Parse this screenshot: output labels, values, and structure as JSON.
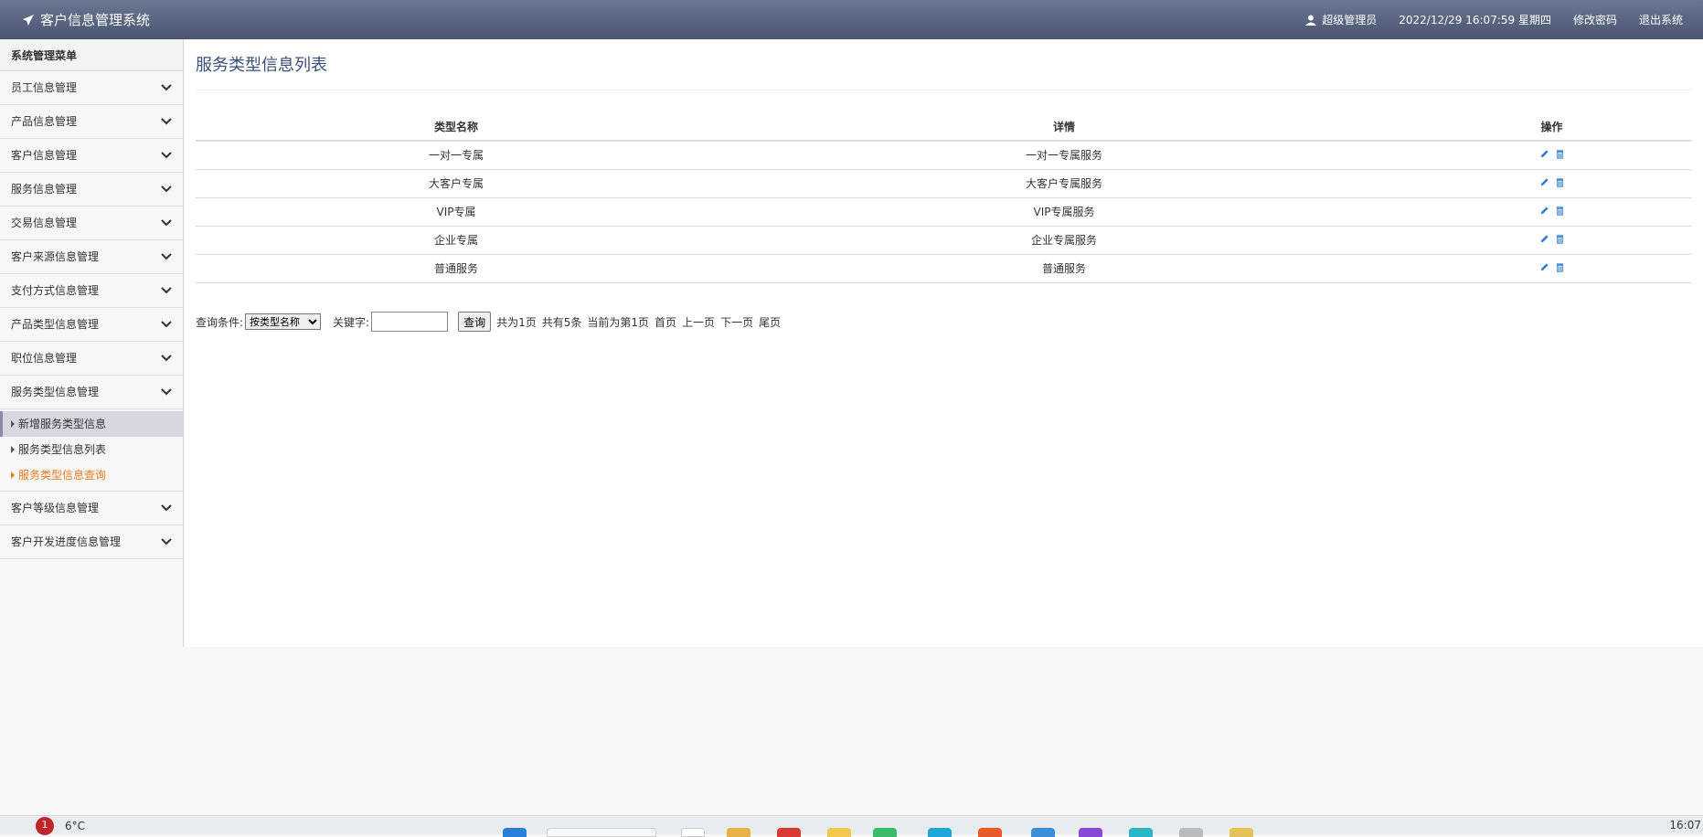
{
  "app": {
    "title": "客户信息管理系统",
    "user": "超级管理员",
    "datetime": "2022/12/29 16:07:59 星期四",
    "change_password": "修改密码",
    "logout": "退出系统"
  },
  "sidebar": {
    "header": "系统管理菜单",
    "items_top": [
      {
        "label": "员工信息管理"
      },
      {
        "label": "产品信息管理"
      },
      {
        "label": "客户信息管理"
      },
      {
        "label": "服务信息管理"
      },
      {
        "label": "交易信息管理"
      },
      {
        "label": "客户来源信息管理"
      },
      {
        "label": "支付方式信息管理"
      },
      {
        "label": "产品类型信息管理"
      },
      {
        "label": "职位信息管理"
      },
      {
        "label": "服务类型信息管理"
      }
    ],
    "subitems": [
      {
        "label": "新增服务类型信息"
      },
      {
        "label": "服务类型信息列表"
      },
      {
        "label": "服务类型信息查询"
      }
    ],
    "items_bottom": [
      {
        "label": "客户等级信息管理"
      },
      {
        "label": "客户开发进度信息管理"
      }
    ]
  },
  "main": {
    "title": "服务类型信息列表",
    "columns": [
      "类型名称",
      "详情",
      "操作"
    ],
    "rows": [
      {
        "name": "一对一专属",
        "detail": "一对一专属服务"
      },
      {
        "name": "大客户专属",
        "detail": "大客户专属服务"
      },
      {
        "name": "VIP专属",
        "detail": "VIP专属服务"
      },
      {
        "name": "企业专属",
        "detail": "企业专属服务"
      },
      {
        "name": "普通服务",
        "detail": "普通服务"
      }
    ],
    "search": {
      "condition_label": "查询条件:",
      "condition_value": "按类型名称",
      "keyword_label": "关键字:",
      "keyword_value": "",
      "query_button": "查询"
    },
    "pager": {
      "total_pages": "共为1页",
      "total_records": "共有5条",
      "current": "当前为第1页",
      "first": "首页",
      "prev": "上一页",
      "next": "下一页",
      "last": "尾页"
    }
  },
  "taskbar": {
    "badge": "1",
    "weather": "6°C",
    "clock": "16:07"
  },
  "colors": {
    "topbar": "#5a6680",
    "title": "#3b4f7a",
    "icon_blue": "#2f7fd1",
    "submenu_highlight": "#e87b1e"
  }
}
